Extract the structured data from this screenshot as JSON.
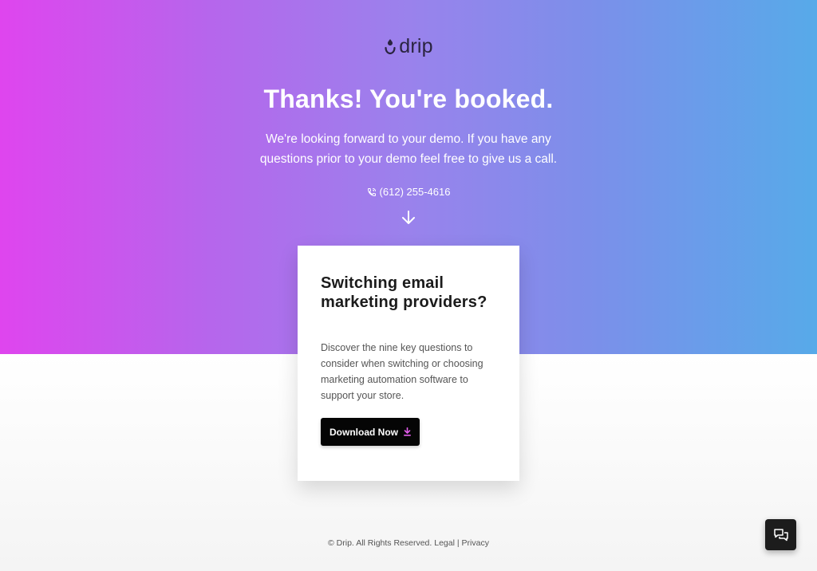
{
  "colors": {
    "gradient_start": "#df45ee",
    "gradient_end": "#57aae9",
    "button_bg": "#050505",
    "download_icon": "#e15dea"
  },
  "brand": {
    "logo_text": "drip",
    "logo_icon": "drip-smile-icon"
  },
  "hero": {
    "title": "Thanks! You're booked.",
    "subtitle": "We're looking forward to your demo. If you have any questions prior to your demo feel free to give us a call.",
    "phone": "(612) 255-4616",
    "phone_icon": "phone-icon",
    "scroll_icon": "arrow-down-icon"
  },
  "card": {
    "title": "Switching email marketing providers?",
    "description": "Discover the nine key questions to consider when switching or choosing marketing automation software to support your store.",
    "button_label": "Download Now",
    "button_icon": "download-icon"
  },
  "footer": {
    "copyright": "© Drip. All Rights Reserved.",
    "legal": "Legal",
    "separator": "|",
    "privacy": "Privacy"
  },
  "chat": {
    "icon": "chat-bubbles-icon"
  }
}
